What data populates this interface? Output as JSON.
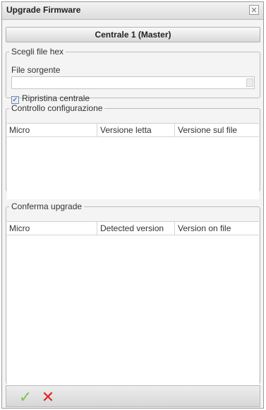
{
  "window": {
    "title": "Upgrade Firmware",
    "close_label": "✕"
  },
  "central_bar": {
    "label": "Centrale 1 (Master)"
  },
  "hex_group": {
    "legend": "Scegli file hex",
    "source_label": "File sorgente",
    "source_value": "",
    "restore_label": "Ripristina centrale",
    "restore_checked": true
  },
  "config_check": {
    "legend": "Controllo configurazione",
    "columns": [
      "Micro",
      "Versione letta",
      "Versione sul file"
    ],
    "rows": []
  },
  "upgrade_confirm": {
    "legend": "Conferma upgrade",
    "columns": [
      "Micro",
      "Detected version",
      "Version on file"
    ],
    "rows": []
  },
  "footer": {
    "ok_icon": "checkmark-icon",
    "cancel_icon": "cross-icon",
    "ok_glyph": "✓",
    "cancel_glyph": "✕",
    "colors": {
      "ok": "#7bc54f",
      "cancel": "#e0261f"
    }
  }
}
